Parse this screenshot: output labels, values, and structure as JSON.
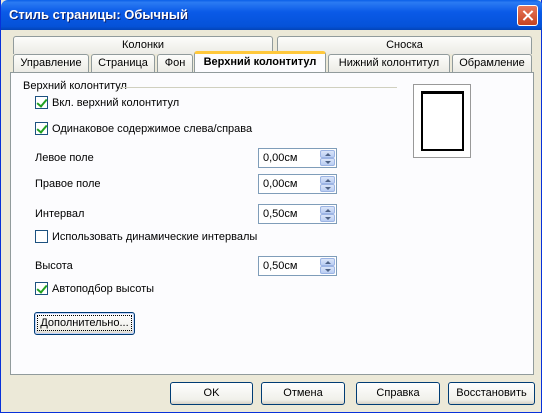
{
  "window": {
    "title": "Стиль страницы: Обычный"
  },
  "tabs_top": [
    {
      "label": "Колонки"
    },
    {
      "label": "Сноска"
    }
  ],
  "tabs_bottom": [
    {
      "label": "Управление"
    },
    {
      "label": "Страница"
    },
    {
      "label": "Фон"
    },
    {
      "label": "Верхний колонтитул",
      "active": true
    },
    {
      "label": "Нижний колонтитул"
    },
    {
      "label": "Обрамление"
    }
  ],
  "header_section": {
    "group_label": "Верхний колонтитул",
    "enable_header": {
      "label": "Вкл. верхний колонтитул",
      "checked": true
    },
    "same_content": {
      "label": "Одинаковое содержимое слева/справа",
      "checked": true
    },
    "left_margin": {
      "label": "Левое поле",
      "value": "0,00см"
    },
    "right_margin": {
      "label": "Правое поле",
      "value": "0,00см"
    },
    "spacing": {
      "label": "Интервал",
      "value": "0,50см"
    },
    "dynamic_spacing": {
      "label": "Использовать динамические интервалы",
      "checked": false
    },
    "height": {
      "label": "Высота",
      "value": "0,50см"
    },
    "autofit_height": {
      "label": "Автоподбор высоты",
      "checked": true
    },
    "more_button": "Дополнительно..."
  },
  "footer_buttons": {
    "ok": "OK",
    "cancel": "Отмена",
    "help": "Справка",
    "reset": "Восстановить"
  }
}
